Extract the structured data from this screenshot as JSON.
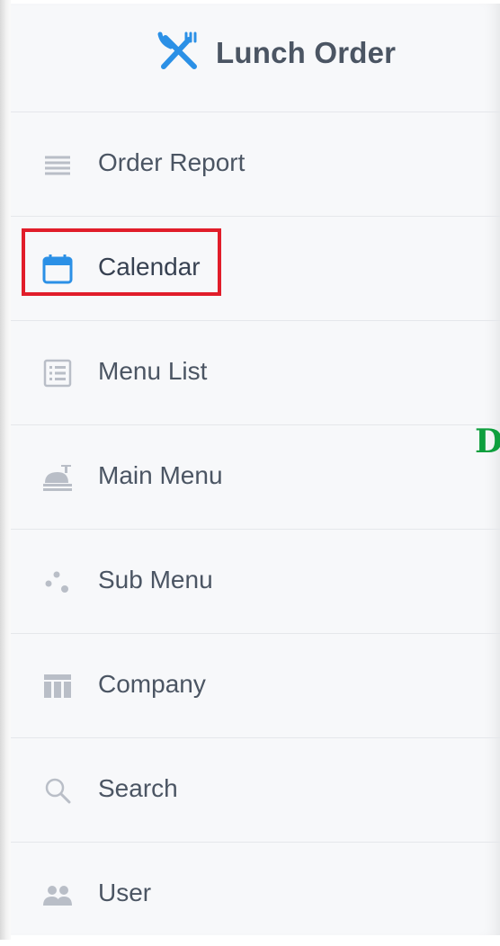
{
  "app": {
    "title": "Lunch Order",
    "icon": "utensils-crossed-icon",
    "accent_color": "#2b90e6"
  },
  "sidebar": {
    "items": [
      {
        "label": "Order Report",
        "icon": "list-lines-icon"
      },
      {
        "label": "Calendar",
        "icon": "calendar-icon",
        "active": true
      },
      {
        "label": "Menu List",
        "icon": "list-box-icon"
      },
      {
        "label": "Main Menu",
        "icon": "food-tray-icon"
      },
      {
        "label": "Sub Menu",
        "icon": "dots-cluster-icon"
      },
      {
        "label": "Company",
        "icon": "table-columns-icon"
      },
      {
        "label": "Search",
        "icon": "magnifier-icon"
      },
      {
        "label": "User",
        "icon": "users-icon"
      }
    ]
  },
  "overlay": {
    "highlight_color": "#e11d2a",
    "edge_text": "D",
    "edge_text_color": "#0e9f3e"
  }
}
